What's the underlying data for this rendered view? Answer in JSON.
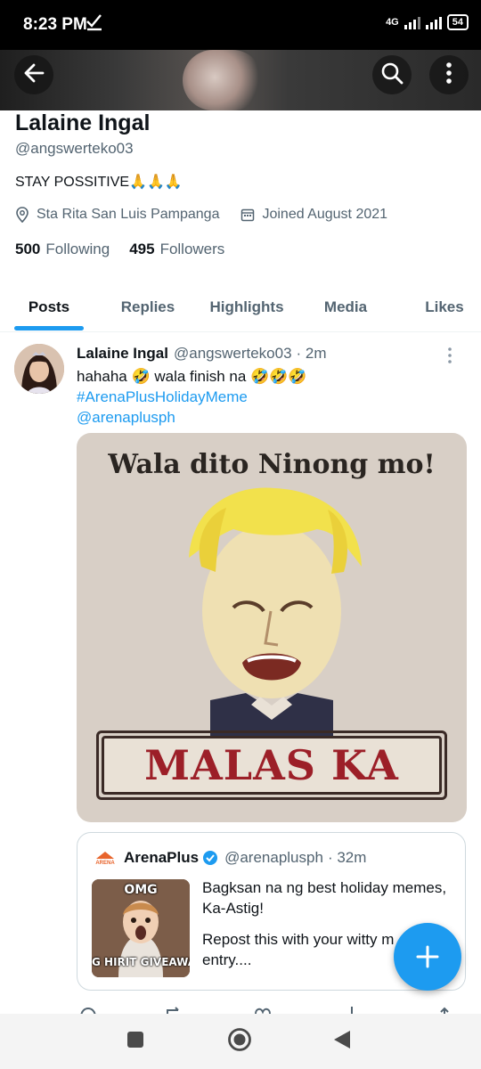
{
  "status_bar": {
    "time": "8:23 PM",
    "network": "4G",
    "battery": "54"
  },
  "header": {
    "back_icon": "arrow-left-icon",
    "search_icon": "search-icon",
    "more_icon": "more-vertical-icon"
  },
  "profile": {
    "name": "Lalaine Ingal",
    "handle": "@angswerteko03",
    "bio": "STAY POSSITIVE🙏🙏🙏",
    "location": "Sta Rita San Luis Pampanga",
    "joined": "Joined August 2021",
    "following_count": "500",
    "following_label": "Following",
    "followers_count": "495",
    "followers_label": "Followers"
  },
  "tabs": [
    {
      "label": "Posts",
      "active": true
    },
    {
      "label": "Replies",
      "active": false
    },
    {
      "label": "Highlights",
      "active": false
    },
    {
      "label": "Media",
      "active": false
    },
    {
      "label": "Likes",
      "active": false
    }
  ],
  "post": {
    "author_name": "Lalaine Ingal",
    "author_handle": "@angswerteko03",
    "time": "· 2m",
    "text": "hahaha 🤣 wala finish na 🤣🤣🤣",
    "hashtag": "#ArenaPlusHolidayMeme",
    "mention": "@arenaplusph",
    "image": {
      "top_text": "Wala dito Ninong mo!",
      "bottom_text": "MALAS KA"
    },
    "quote": {
      "author_name": "ArenaPlus",
      "author_handle": "@arenaplusph",
      "time": "· 32m",
      "line1": "Bagksan na ng best holiday memes, Ka-Astig!",
      "line2": "Repost this with your witty m",
      "line3": "entry....",
      "thumb_top": "OMG",
      "thumb_bottom": "G HIRIT GIVEAWA",
      "logo_text": "ARENA"
    }
  },
  "fab": {
    "icon": "plus-icon"
  },
  "nav": {
    "recents_icon": "square-icon",
    "home_icon": "circle-icon",
    "back_icon": "triangle-back-icon"
  }
}
